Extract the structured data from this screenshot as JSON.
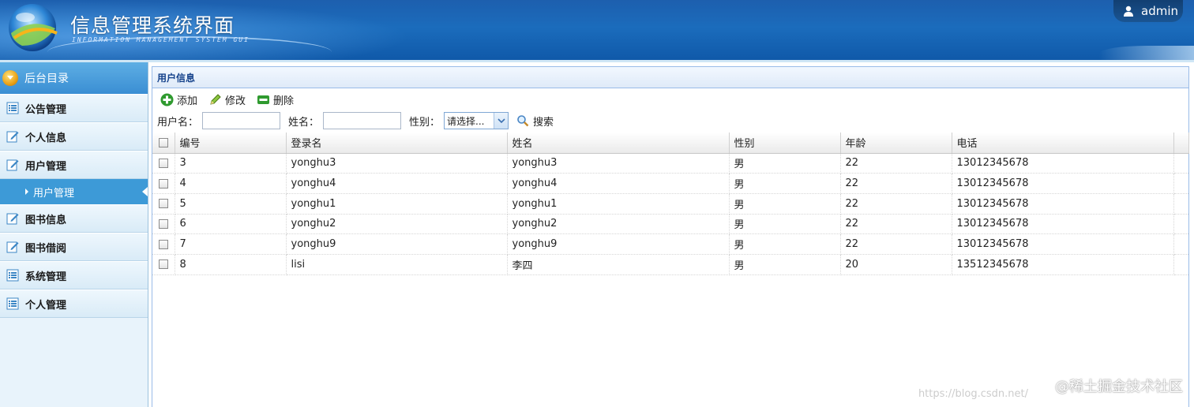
{
  "header": {
    "title": "信息管理系统界面",
    "subtitle": "INFORMATION MANAGEMENT SYSTEM GUI",
    "user": "admin"
  },
  "sidebar": {
    "heading": "后台目录",
    "items": [
      {
        "label": "公告管理",
        "icon": "list-icon"
      },
      {
        "label": "个人信息",
        "icon": "edit-icon"
      },
      {
        "label": "用户管理",
        "icon": "edit-icon"
      },
      {
        "label": "用户管理",
        "sub": true
      },
      {
        "label": "图书信息",
        "icon": "edit-icon"
      },
      {
        "label": "图书借阅",
        "icon": "edit-icon"
      },
      {
        "label": "系统管理",
        "icon": "list-icon"
      },
      {
        "label": "个人管理",
        "icon": "list-icon"
      }
    ]
  },
  "panel": {
    "title": "用户信息",
    "toolbar": {
      "add": "添加",
      "edit": "修改",
      "delete": "删除"
    },
    "filter": {
      "username_label": "用户名：",
      "username_value": "",
      "name_label": "姓名：",
      "name_value": "",
      "gender_label": "性别：",
      "gender_selected": "请选择...",
      "search": "搜索"
    },
    "columns": [
      "编号",
      "登录名",
      "姓名",
      "性别",
      "年龄",
      "电话"
    ],
    "rows": [
      [
        "3",
        "yonghu3",
        "yonghu3",
        "男",
        "22",
        "13012345678"
      ],
      [
        "4",
        "yonghu4",
        "yonghu4",
        "男",
        "22",
        "13012345678"
      ],
      [
        "5",
        "yonghu1",
        "yonghu1",
        "男",
        "22",
        "13012345678"
      ],
      [
        "6",
        "yonghu2",
        "yonghu2",
        "男",
        "22",
        "13012345678"
      ],
      [
        "7",
        "yonghu9",
        "yonghu9",
        "男",
        "22",
        "13012345678"
      ],
      [
        "8",
        "lisi",
        "李四",
        "男",
        "20",
        "13512345678"
      ]
    ]
  },
  "watermark": "@稀土掘金技术社区",
  "watermark_url": "https://blog.csdn.net/"
}
